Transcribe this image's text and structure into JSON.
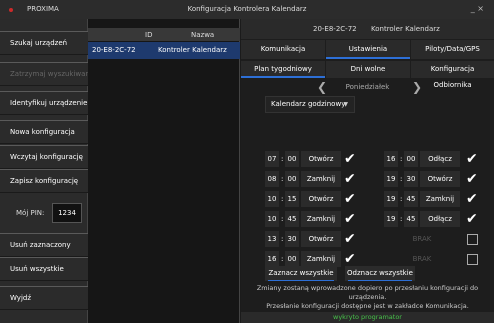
{
  "window": {
    "app_name": "PROXIMA",
    "title": "Konfiguracja Kontrolera Kalendarz",
    "controls": "_ ×"
  },
  "colors": {
    "accent": "#2d6fd6",
    "selected_row": "#1e3a6e",
    "status_ok": "#47c14a",
    "brand_dot": "#cc2a2a"
  },
  "sidebar": {
    "search": "Szukaj urządzeń",
    "stop_search": "Zatrzymaj wyszukiwanie",
    "identify": "Identyfikuj urządzenie",
    "new_config": "Nowa konfiguracja",
    "load_config": "Wczytaj konfigurację",
    "save_config": "Zapisz konfigurację",
    "pin_label": "Mój PIN:",
    "pin_value": "1234",
    "remove_selected": "Usuń zaznaczony",
    "remove_all": "Usuń wszystkie",
    "exit": "Wyjdź"
  },
  "devices": {
    "col_id": "ID",
    "col_name": "Nazwa",
    "rows": [
      {
        "id": "20-E8-2C-72",
        "name": "Kontroler Kalendarz"
      }
    ]
  },
  "panel": {
    "device_id": "20-E8-2C-72",
    "device_name": "Kontroler Kalendarz",
    "tabs": [
      "Komunikacja",
      "Ustawienia",
      "Piloty/Data/GPS"
    ],
    "subtabs": [
      "Plan tygodniowy",
      "Dni wolne",
      "Konfiguracja Odbiornika"
    ],
    "day": "Poniedziałek",
    "prev_icon": "chevron-left-icon",
    "next_icon": "chevron-right-icon",
    "mode": "Kalendarz godzinowy",
    "left_schedule": [
      {
        "h": "07",
        "m": "00",
        "action": "Otwórz"
      },
      {
        "h": "08",
        "m": "00",
        "action": "Zamknij"
      },
      {
        "h": "10",
        "m": "15",
        "action": "Otwórz"
      },
      {
        "h": "10",
        "m": "45",
        "action": "Zamknij"
      },
      {
        "h": "13",
        "m": "30",
        "action": "Otwórz"
      },
      {
        "h": "16",
        "m": "00",
        "action": "Zamknij"
      }
    ],
    "right_schedule": [
      {
        "h": "16",
        "m": "00",
        "action": "Odłącz"
      },
      {
        "h": "19",
        "m": "30",
        "action": "Otwórz"
      },
      {
        "h": "19",
        "m": "45",
        "action": "Zamknij"
      },
      {
        "h": "19",
        "m": "45",
        "action": "Odłącz"
      },
      {
        "brak": "BRAK"
      },
      {
        "brak": "BRAK"
      }
    ],
    "select_all": "Zaznacz wszystkie",
    "deselect_all": "Odznacz wszystkie",
    "info_line1": "Zmiany zostaną wprowadzone dopiero po przesłaniu konfiguracji do urządzenia.",
    "info_line2": "Przesłanie konfiguracji dostępne jest w zakładce Komunikacja.",
    "status": "wykryto programator"
  }
}
